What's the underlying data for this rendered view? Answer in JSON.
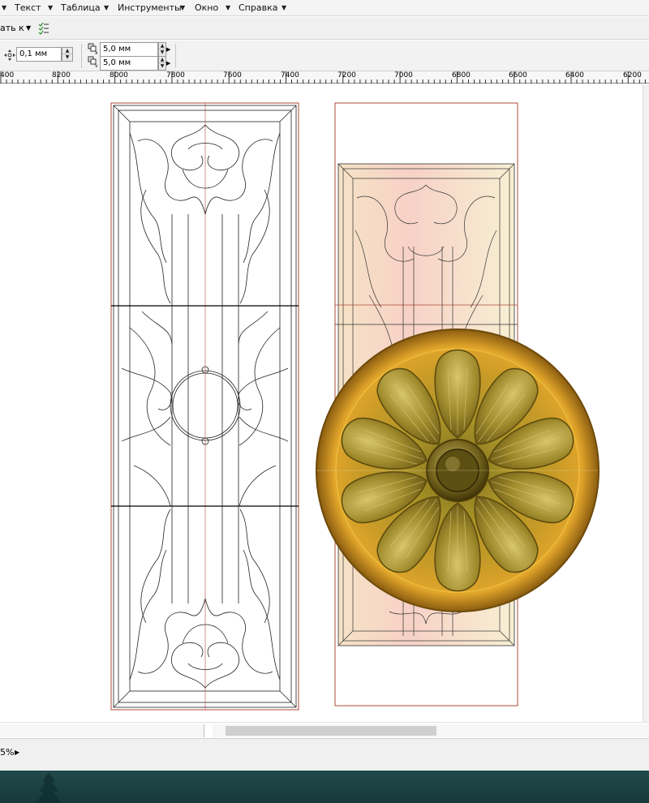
{
  "menubar": {
    "items": [
      {
        "label": "Текст"
      },
      {
        "label": "Таблица"
      },
      {
        "label": "Инструменты"
      },
      {
        "label": "Окно"
      },
      {
        "label": "Справка"
      }
    ]
  },
  "toolbar1": {
    "partial_label": "ать к"
  },
  "propbar": {
    "nudge_value": "0,1 мм",
    "dup_x_value": "5,0 мм",
    "dup_y_value": "5,0 мм"
  },
  "ruler": {
    "labels": [
      "400",
      "8200",
      "8000",
      "7800",
      "7600",
      "7400",
      "7200",
      "7000",
      "6800",
      "6600",
      "6400",
      "6200"
    ]
  },
  "statusbar": {
    "zoom_text": "5%"
  }
}
